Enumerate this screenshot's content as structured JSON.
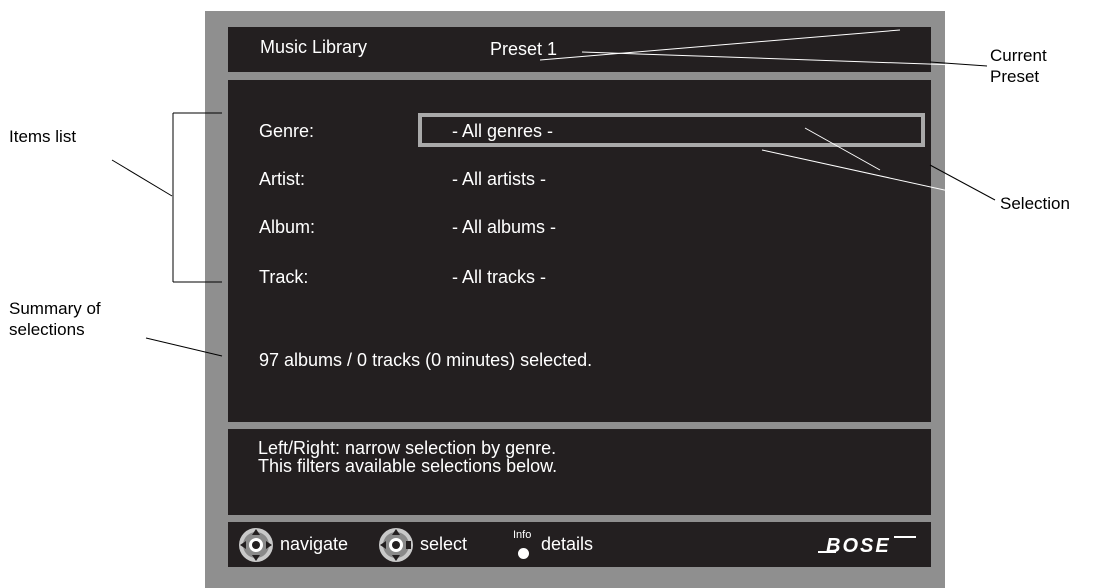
{
  "header": {
    "title": "Music Library",
    "preset": "Preset 1"
  },
  "fields": [
    {
      "label": "Genre:",
      "value": "- All genres -"
    },
    {
      "label": "Artist:",
      "value": "- All artists -"
    },
    {
      "label": "Album:",
      "value": "- All albums -"
    },
    {
      "label": "Track:",
      "value": "- All tracks -"
    }
  ],
  "summary": "97 albums / 0 tracks (0 minutes) selected.",
  "help": {
    "line1": "Left/Right: narrow selection by genre.",
    "line2": "This filters available selections below."
  },
  "footer": {
    "navigate_label": "navigate",
    "select_label": "select",
    "info_label": "Info",
    "details_label": "details",
    "brand": "BOSE"
  },
  "callouts": {
    "current_preset_line1": "Current",
    "current_preset_line2": "Preset",
    "selection": "Selection",
    "items_list": "Items list",
    "summary_line1": "Summary of",
    "summary_line2": "selections"
  },
  "icons": {
    "navigate": "navigation-pad-icon",
    "select": "select-pad-icon",
    "info": "info-button-icon",
    "brand": "bose-logo"
  },
  "colors": {
    "panel": "#231f20",
    "frame": "#8f8f8f",
    "selection_border": "#a9a9a9",
    "text": "#ffffff"
  }
}
